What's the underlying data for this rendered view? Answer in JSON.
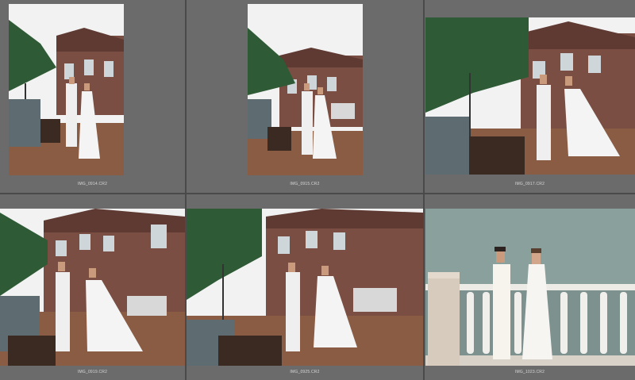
{
  "grid": {
    "cells": [
      {
        "filename": "IMG_0914.CR2",
        "orientation": "portrait",
        "scene": "terrace-umbrella"
      },
      {
        "filename": "IMG_0915.CR2",
        "orientation": "portrait",
        "scene": "terrace-umbrella"
      },
      {
        "filename": "IMG_0917.CR2",
        "orientation": "landscape",
        "scene": "terrace-umbrella"
      },
      {
        "filename": "IMG_0919.CR2",
        "orientation": "landscape",
        "scene": "terrace-umbrella"
      },
      {
        "filename": "IMG_0925.CR2",
        "orientation": "landscape",
        "scene": "terrace-umbrella"
      },
      {
        "filename": "IMG_1023.CR2",
        "orientation": "landscape",
        "scene": "seaside-balustrade"
      }
    ]
  },
  "colors": {
    "background": "#4a4a4a",
    "cell": "#6b6b6b",
    "caption": "#d8d8d8"
  }
}
